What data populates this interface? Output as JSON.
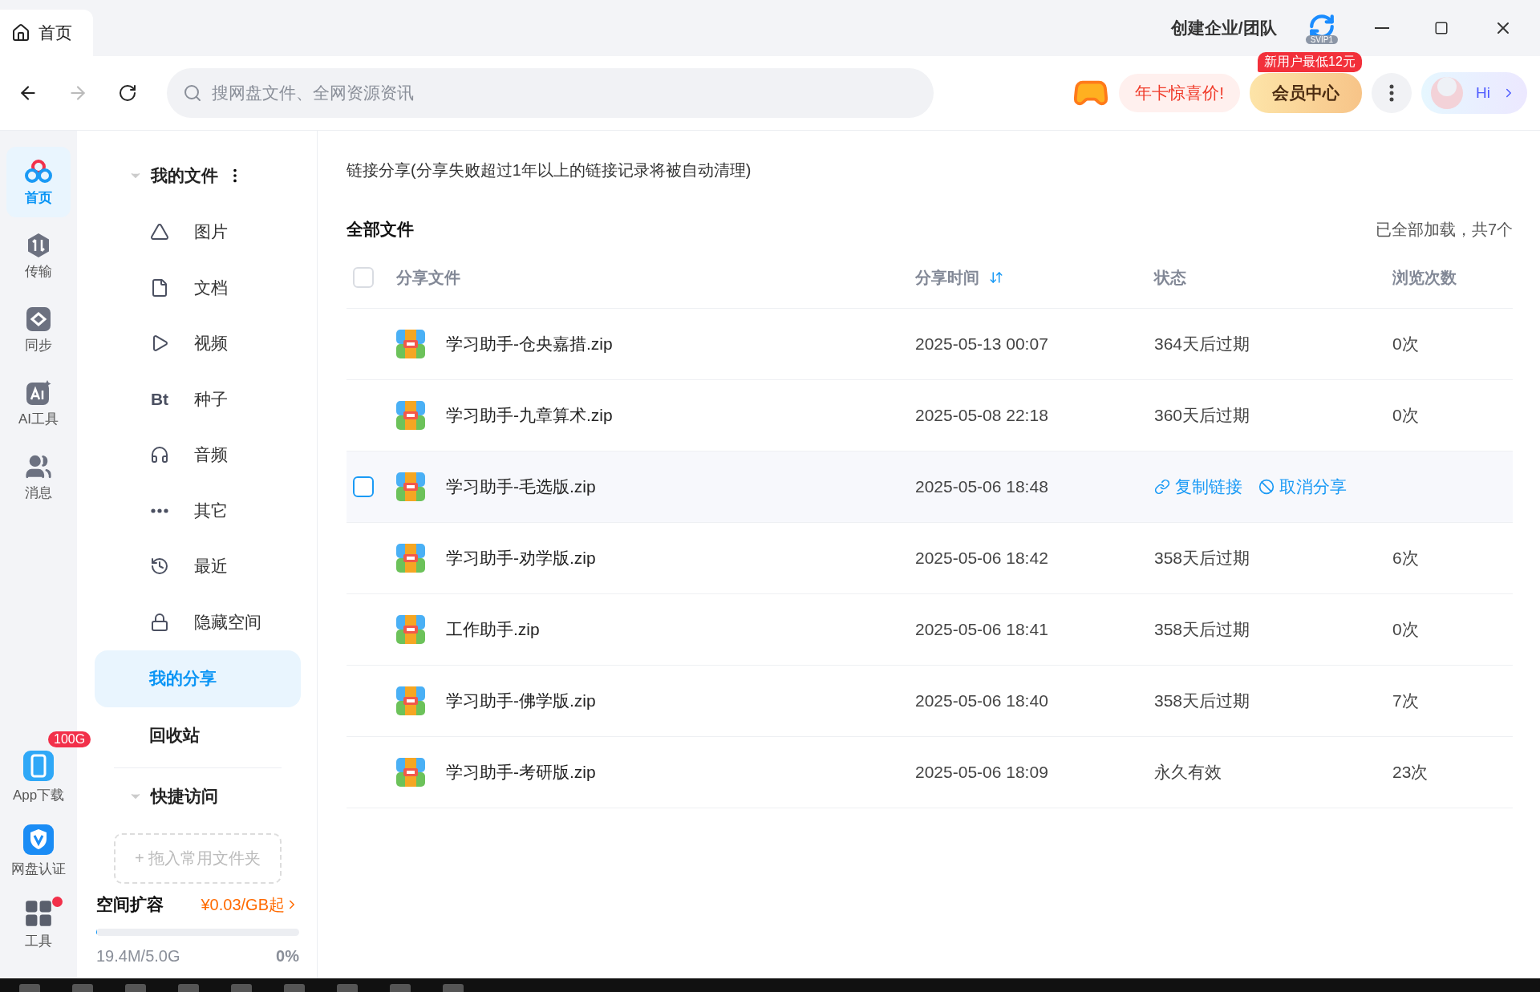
{
  "tab": {
    "label": "首页"
  },
  "titlebar": {
    "team_link": "创建企业/团队",
    "svip_badge": "SVIP1"
  },
  "toolbar": {
    "search": {
      "placeholder": "搜网盘文件、全网资源资讯"
    },
    "promo": "年卡惊喜价!",
    "member_button": "会员中心",
    "member_tag": "新用户最低12元",
    "hi": "Hi"
  },
  "rail": [
    {
      "kind": "home",
      "label": "首页",
      "selected": true
    },
    {
      "kind": "transfer",
      "label": "传输",
      "selected": false
    },
    {
      "kind": "sync",
      "label": "同步",
      "selected": false
    },
    {
      "kind": "ai",
      "label": "AI工具",
      "selected": false
    },
    {
      "kind": "message",
      "label": "消息",
      "selected": false
    }
  ],
  "rail_bottom": [
    {
      "kind": "app",
      "label": "App下载",
      "badge": "100G",
      "dot": false
    },
    {
      "kind": "verify",
      "label": "网盘认证",
      "dot": false
    },
    {
      "kind": "tools",
      "label": "工具",
      "dot": true
    }
  ],
  "nav": {
    "my_files": "我的文件",
    "items": [
      {
        "kind": "image",
        "label": "图片"
      },
      {
        "kind": "doc",
        "label": "文档"
      },
      {
        "kind": "video",
        "label": "视频"
      },
      {
        "kind": "bt",
        "label": "种子",
        "glyph": "Bt"
      },
      {
        "kind": "audio",
        "label": "音频"
      },
      {
        "kind": "other",
        "label": "其它"
      },
      {
        "kind": "recent",
        "label": "最近"
      },
      {
        "kind": "hidden",
        "label": "隐藏空间"
      }
    ],
    "sections": [
      {
        "label": "我的分享",
        "selected": true
      },
      {
        "label": "回收站",
        "selected": false
      }
    ],
    "quick_access": "快捷访问",
    "drop_hint": "+ 拖入常用文件夹",
    "storage": {
      "title": "空间扩容",
      "price": "¥0.03/GB起",
      "level": 0.004,
      "used": "19.4M/5.0G",
      "percent": "0%"
    }
  },
  "content": {
    "notice": "链接分享(分享失败超过1年以上的链接记录将被自动清理)",
    "heading": "全部文件",
    "count": "已全部加载，共7个",
    "select_all": {
      "checked": false
    },
    "columns": [
      "分享文件",
      "分享时间",
      "状态",
      "浏览次数"
    ],
    "rows": [
      {
        "name": "学习助手-仓央嘉措.zip",
        "time": "2025-05-13 00:07",
        "status": "364天后过期",
        "views": "0次",
        "hovered": false
      },
      {
        "name": "学习助手-九章算术.zip",
        "time": "2025-05-08 22:18",
        "status": "360天后过期",
        "views": "0次",
        "hovered": false
      },
      {
        "name": "学习助手-毛选版.zip",
        "time": "2025-05-06 18:48",
        "hovered": true,
        "actions": [
          "复制链接",
          "取消分享"
        ]
      },
      {
        "name": "学习助手-劝学版.zip",
        "time": "2025-05-06 18:42",
        "status": "358天后过期",
        "views": "6次",
        "hovered": false
      },
      {
        "name": "工作助手.zip",
        "time": "2025-05-06 18:41",
        "status": "358天后过期",
        "views": "0次",
        "hovered": false
      },
      {
        "name": "学习助手-佛学版.zip",
        "time": "2025-05-06 18:40",
        "status": "358天后过期",
        "views": "7次",
        "hovered": false
      },
      {
        "name": "学习助手-考研版.zip",
        "time": "2025-05-06 18:09",
        "status": "永久有效",
        "views": "23次",
        "hovered": false
      }
    ]
  }
}
